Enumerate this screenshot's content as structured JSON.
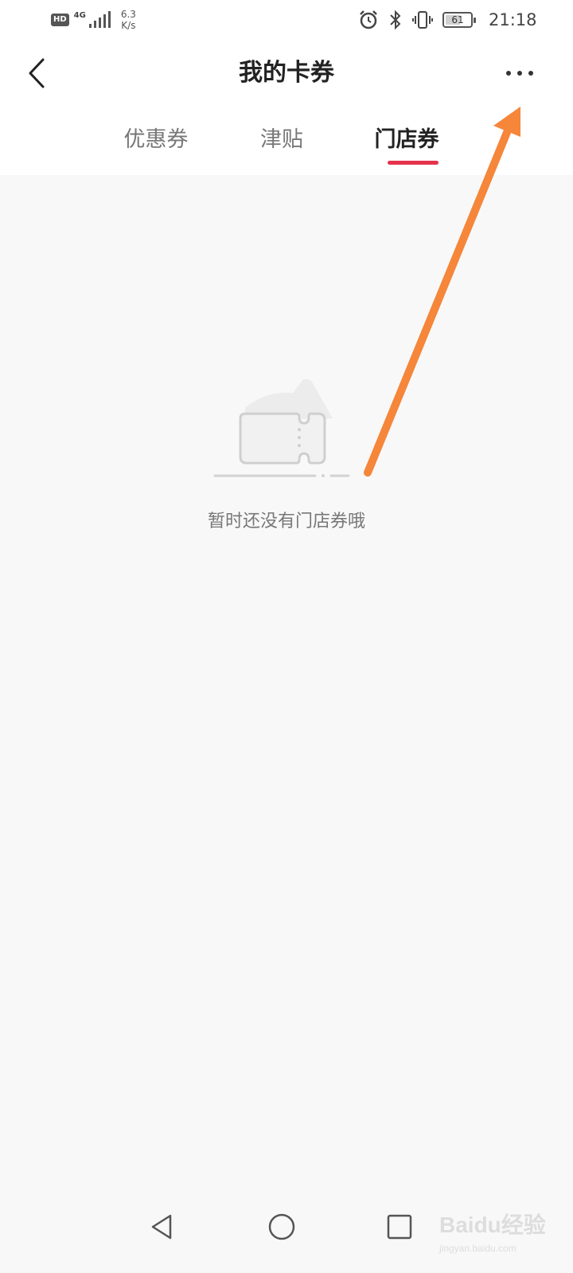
{
  "status_bar": {
    "hd": "HD",
    "network": "4G",
    "speed_value": "6.3",
    "speed_unit": "K/s",
    "battery": "61",
    "battery_level": 0.61,
    "time": "21:18",
    "icons": [
      "alarm-icon",
      "bluetooth-icon",
      "vibrate-icon",
      "battery-icon",
      "signal-icon"
    ]
  },
  "header": {
    "title": "我的卡券",
    "back_icon": "chevron-left-icon",
    "more_icon": "more-dots-icon"
  },
  "tabs": {
    "items": [
      {
        "label": "优惠券",
        "active": false
      },
      {
        "label": "津贴",
        "active": false
      },
      {
        "label": "门店券",
        "active": true
      }
    ],
    "indicator_color": "#e5334d"
  },
  "empty_state": {
    "icon": "ticket-icon",
    "message": "暂时还没有门店券哦"
  },
  "annotation": {
    "icon": "arrow-icon",
    "color": "#f5863a"
  },
  "nav_bar": {
    "icons": [
      "back-triangle-icon",
      "home-circle-icon",
      "recents-square-icon"
    ]
  },
  "watermark": {
    "logo": "Baidu经验",
    "url": "jingyan.baidu.com"
  }
}
